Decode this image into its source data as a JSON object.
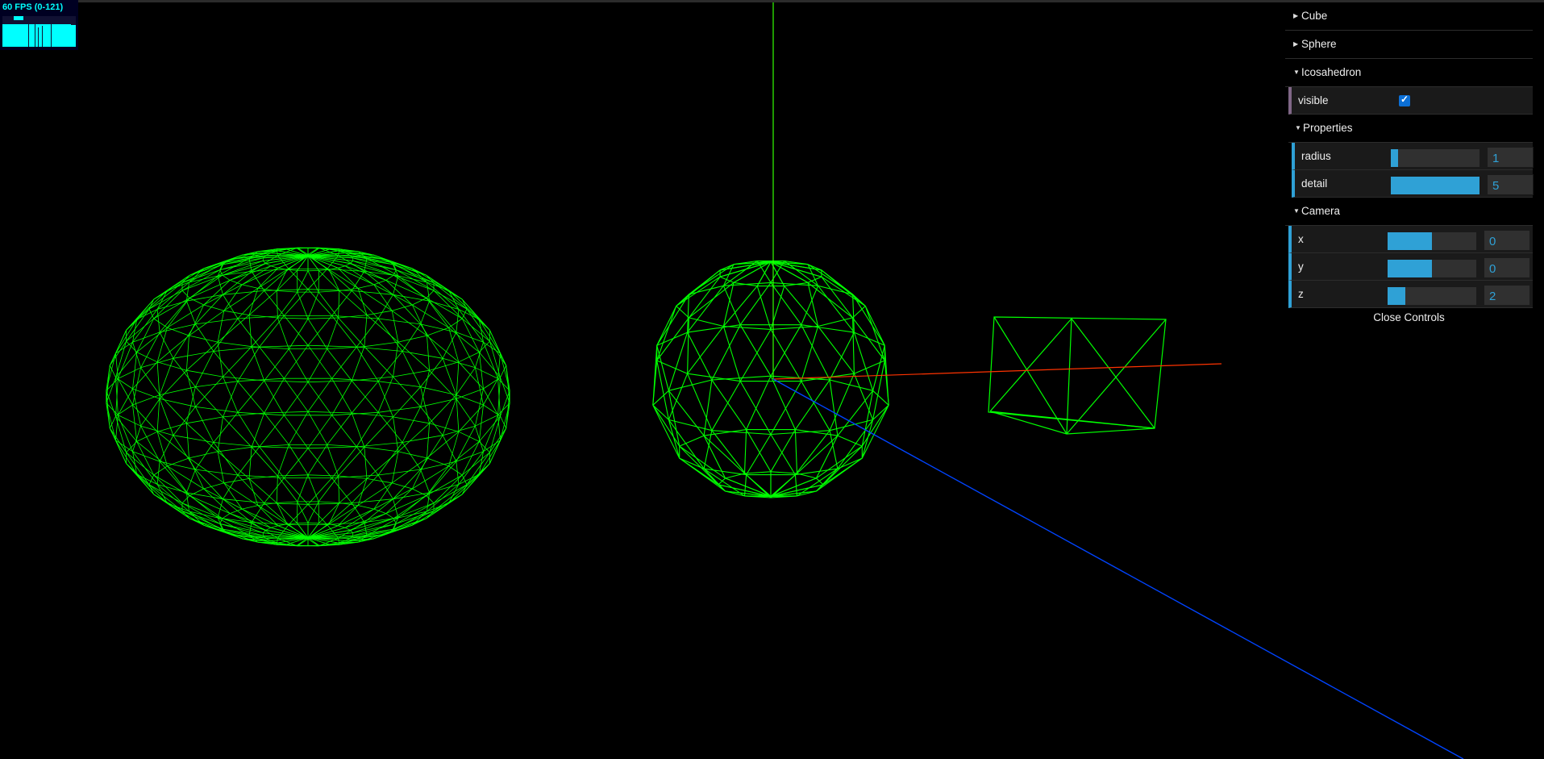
{
  "stats": {
    "fps_text": "60 FPS (0-121)"
  },
  "gui": {
    "folders": {
      "cube": {
        "title": "Cube"
      },
      "sphere": {
        "title": "Sphere"
      },
      "icosahedron": {
        "title": "Icosahedron",
        "visible_label": "visible",
        "visible_checked": true,
        "properties": {
          "title": "Properties",
          "radius": {
            "label": "radius",
            "value": "1",
            "fraction": 0.08
          },
          "detail": {
            "label": "detail",
            "value": "5",
            "fraction": 1.0
          }
        }
      },
      "camera": {
        "title": "Camera",
        "x": {
          "label": "x",
          "value": "0",
          "fraction": 0.5
        },
        "y": {
          "label": "y",
          "value": "0",
          "fraction": 0.5
        },
        "z": {
          "label": "z",
          "value": "2",
          "fraction": 0.2
        }
      }
    },
    "close_label": "Close Controls"
  },
  "colors": {
    "wireframe": "#00ff00",
    "axis_x": "#ff3300",
    "axis_y": "#33ff00",
    "axis_z": "#0044ff",
    "accent": "#2fa1d6"
  }
}
